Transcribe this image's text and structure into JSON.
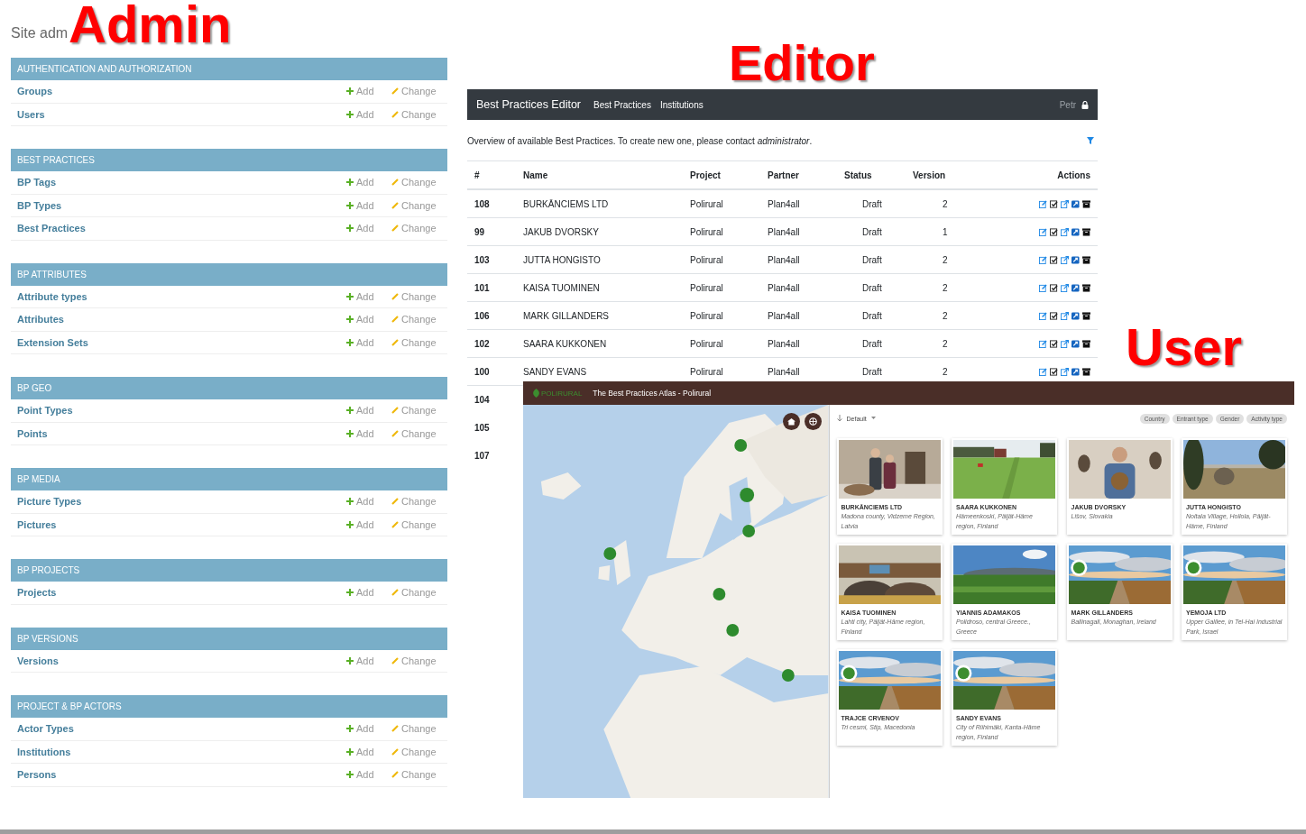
{
  "admin": {
    "heading": "Site adm",
    "label": "Admin",
    "sections": [
      {
        "title": "AUTHENTICATION AND AUTHORIZATION",
        "models": [
          {
            "name": "Groups",
            "add": "Add",
            "change": "Change"
          },
          {
            "name": "Users",
            "add": "Add",
            "change": "Change"
          }
        ]
      },
      {
        "title": "BEST PRACTICES",
        "models": [
          {
            "name": "BP Tags",
            "add": "Add",
            "change": "Change"
          },
          {
            "name": "BP Types",
            "add": "Add",
            "change": "Change"
          },
          {
            "name": "Best Practices",
            "add": "Add",
            "change": "Change"
          }
        ]
      },
      {
        "title": "BP ATTRIBUTES",
        "models": [
          {
            "name": "Attribute types",
            "add": "Add",
            "change": "Change"
          },
          {
            "name": "Attributes",
            "add": "Add",
            "change": "Change"
          },
          {
            "name": "Extension Sets",
            "add": "Add",
            "change": "Change"
          }
        ]
      },
      {
        "title": "BP GEO",
        "models": [
          {
            "name": "Point Types",
            "add": "Add",
            "change": "Change"
          },
          {
            "name": "Points",
            "add": "Add",
            "change": "Change"
          }
        ]
      },
      {
        "title": "BP MEDIA",
        "models": [
          {
            "name": "Picture Types",
            "add": "Add",
            "change": "Change"
          },
          {
            "name": "Pictures",
            "add": "Add",
            "change": "Change"
          }
        ]
      },
      {
        "title": "BP PROJECTS",
        "models": [
          {
            "name": "Projects",
            "add": "Add",
            "change": "Change"
          }
        ]
      },
      {
        "title": "BP VERSIONS",
        "models": [
          {
            "name": "Versions",
            "add": "Add",
            "change": "Change"
          }
        ]
      },
      {
        "title": "PROJECT & BP ACTORS",
        "models": [
          {
            "name": "Actor Types",
            "add": "Add",
            "change": "Change"
          },
          {
            "name": "Institutions",
            "add": "Add",
            "change": "Change"
          },
          {
            "name": "Persons",
            "add": "Add",
            "change": "Change"
          }
        ]
      }
    ]
  },
  "editor": {
    "label": "Editor",
    "brand": "Best Practices Editor",
    "nav": [
      "Best Practices",
      "Institutions"
    ],
    "user": "Petr",
    "intro": "Overview of available Best Practices. To create new one, please contact *administrator*.",
    "columns": [
      "#",
      "Name",
      "Project",
      "Partner",
      "Status",
      "Version",
      "Actions"
    ],
    "rows": [
      {
        "id": "108",
        "name": "BURKĀNCIEMS LTD",
        "project": "Polirural",
        "partner": "Plan4all",
        "status": "Draft",
        "version": "2"
      },
      {
        "id": "99",
        "name": "JAKUB DVORSKY",
        "project": "Polirural",
        "partner": "Plan4all",
        "status": "Draft",
        "version": "1"
      },
      {
        "id": "103",
        "name": "JUTTA HONGISTO",
        "project": "Polirural",
        "partner": "Plan4all",
        "status": "Draft",
        "version": "2"
      },
      {
        "id": "101",
        "name": "KAISA TUOMINEN",
        "project": "Polirural",
        "partner": "Plan4all",
        "status": "Draft",
        "version": "2"
      },
      {
        "id": "106",
        "name": "MARK GILLANDERS",
        "project": "Polirural",
        "partner": "Plan4all",
        "status": "Draft",
        "version": "2"
      },
      {
        "id": "102",
        "name": "SAARA KUKKONEN",
        "project": "Polirural",
        "partner": "Plan4all",
        "status": "Draft",
        "version": "2"
      },
      {
        "id": "100",
        "name": "SANDY EVANS",
        "project": "Polirural",
        "partner": "Plan4all",
        "status": "Draft",
        "version": "2"
      },
      {
        "id": "104"
      },
      {
        "id": "105"
      },
      {
        "id": "107"
      }
    ]
  },
  "user": {
    "label": "User",
    "logo": "POLIRURAL",
    "title": "The Best Practices Atlas - Polirural",
    "sort": "Default",
    "filters": [
      "Country",
      "Entrant type",
      "Gender",
      "Activity type"
    ],
    "cards": [
      {
        "title": "BURKĀNCIEMS LTD",
        "place": "Madona county, Vidzeme Region, Latvia"
      },
      {
        "title": "SAARA KUKKONEN",
        "place": "Hämeenkoski, Päijät-Häme region, Finland"
      },
      {
        "title": "JAKUB DVORSKY",
        "place": "Lišov, Slovakia"
      },
      {
        "title": "JUTTA HONGISTO",
        "place": "Noitala Village, Hollola, Päijät-Häme, Finland"
      },
      {
        "title": "KAISA TUOMINEN",
        "place": "Lahti city, Päijät-Häme region, Finland"
      },
      {
        "title": "YIANNIS ADAMAKOS",
        "place": "Polidroso, central Greece., Greece"
      },
      {
        "title": "MARK GILLANDERS",
        "place": "Ballinagall, Monaghan, Ireland"
      },
      {
        "title": "YEMOJA LTD",
        "place": "Upper Galilee, in Tel-Hai Industrial Park, Israel"
      },
      {
        "title": "TRAJCE CRVENOV",
        "place": "Tri cesmi, Stip, Macedonia"
      },
      {
        "title": "SANDY EVANS",
        "place": "City of Riihimäki, Kanta-Häme region, Finland"
      }
    ]
  }
}
